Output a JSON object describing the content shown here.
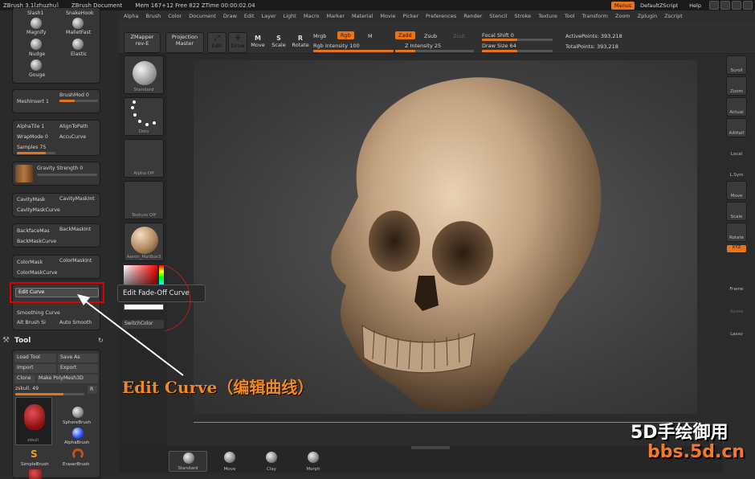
{
  "titlebar": {
    "app": "ZBrush 3.1[zhuzhu]",
    "doc": "ZBrush Document",
    "stats": "Mem 167+12 Free 822 ZTime 00:00:02.04",
    "menus_btn": "Menus",
    "script_btn": "DefaultZScript",
    "help_btn": "Help"
  },
  "menubar": [
    "Alpha",
    "Brush",
    "Color",
    "Document",
    "Draw",
    "Edit",
    "Layer",
    "Light",
    "Macro",
    "Marker",
    "Material",
    "Movie",
    "Picker",
    "Preferences",
    "Render",
    "Stencil",
    "Stroke",
    "Texture",
    "Tool",
    "Transform",
    "Zoom",
    "Zplugin",
    "Zscript"
  ],
  "toolbar": {
    "zmapper": "ZMapper",
    "zmapper_sub": "rev-E",
    "projection": "Projection",
    "projection_sub": "Master",
    "edit": "Edit",
    "draw": "Draw",
    "move": "Move",
    "scale": "Scale",
    "rotate": "Rotate",
    "mrgb": "Mrgb",
    "rgb": "Rgb",
    "m": "M",
    "rgb_intensity": "Rgb Intensity 100",
    "zadd": "Zadd",
    "zsub": "Zsub",
    "zcut": "Zcut",
    "z_intensity": "Z Intensity 25",
    "focal_shift": "Focal Shift 0",
    "draw_size": "Draw Size 64",
    "active_points": "ActivePoints: 393,218",
    "total_points": "TotalPoints: 393,218",
    "rgb_fill": 1.0,
    "z_fill": 0.25,
    "focal_fill": 0.5,
    "draw_size_fill": 0.5
  },
  "left": {
    "brushes": [
      "Slash1",
      "SnakeHook",
      "Magnify",
      "MalletFast",
      "Nudge",
      "Elastic",
      "Gouge"
    ],
    "brushmod": "BrushMod 0",
    "meshinsert": "MeshInsert 1",
    "alphatile": "AlphaTile 1",
    "aligntopath": "AlignToPath",
    "wrapmode": "WrapMode 0",
    "accucurve": "AccuCurve",
    "samples": "Samples 75",
    "gravity": "Gravity Strength 0",
    "cavitymask": "CavityMask",
    "cavitymaskint": "CavityMaskInt",
    "cavitymaskcurve": "CavityMaskCurve",
    "backfacemask": "BackfaceMas",
    "backmaskint": "BackMaskInt",
    "backmaskcurve": "BackMaskCurve",
    "colormask": "ColorMask",
    "colormaskint": "ColorMaskInt",
    "colormaskcurve": "ColorMaskCurve",
    "editcurve": "Edit Curve",
    "smoothingcurve": "Smoothing Curve",
    "altbrush": "Alt Brush Si",
    "autosmooth": "Auto Smooth",
    "tool_title": "Tool",
    "load_tool": "Load Tool",
    "save_as": "Save As",
    "import": "Import",
    "export": "Export",
    "clone": "Clone",
    "make_polymesh": "Make PolyMesh3D",
    "zskull": "zskull. 49",
    "r": "R",
    "tools": [
      "zskull",
      "SphereBrush",
      "AlphaBrush",
      "SimpleBrush",
      "EraserBrush"
    ]
  },
  "shelf": {
    "standard": "Standard",
    "dots": "Dots",
    "alpha_off": "Alpha Off",
    "texture_off": "Texture Off",
    "material": "Aaron_MatBox3",
    "switchcolor": "SwitchColor"
  },
  "right": [
    "Scroll",
    "Zoom",
    "Actual",
    "AAHalf",
    "Local",
    "L.Sym",
    "Move",
    "Scale",
    "Rotate",
    "XYZ",
    "Frame",
    "Xpose",
    "Lasso"
  ],
  "bottom": [
    "Standard",
    "Move",
    "Clay",
    "Morph"
  ],
  "tooltip": "Edit Fade-Off Curve",
  "callout": "Edit Curve（编辑曲线）",
  "watermark": {
    "line1": "5D手绘御用",
    "line2": "bbs.5d.cn"
  },
  "colors": {
    "accent": "#e8741a",
    "highlight": "#e00000",
    "callout": "#f08a1c"
  }
}
